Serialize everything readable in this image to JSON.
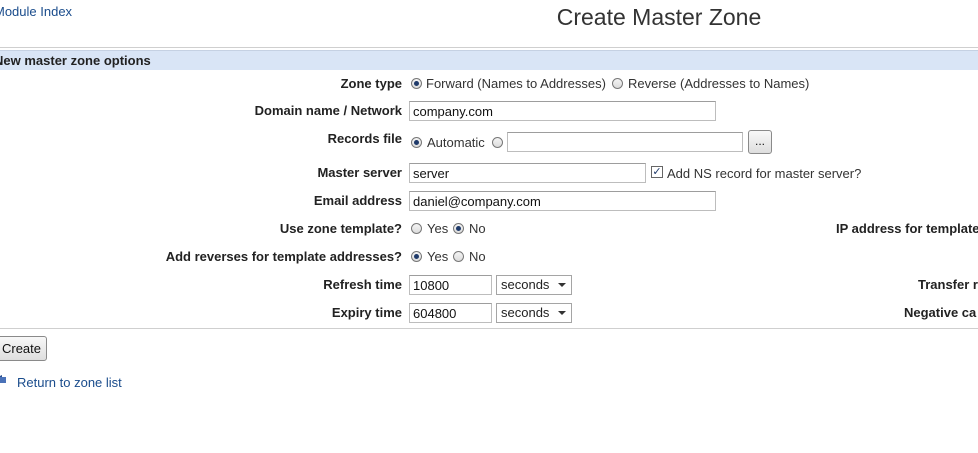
{
  "header": {
    "module_index": "Module Index",
    "title": "Create Master Zone"
  },
  "section": {
    "title": "New master zone options"
  },
  "zone_type": {
    "label": "Zone type",
    "options": [
      "Forward (Names to Addresses)",
      "Reverse (Addresses to Names)"
    ],
    "selected": "Forward (Names to Addresses)"
  },
  "domain": {
    "label": "Domain name / Network",
    "value": "company.com"
  },
  "records_file": {
    "label": "Records file",
    "option_auto": "Automatic",
    "value": "",
    "browse": "..."
  },
  "master_server": {
    "label": "Master server",
    "value": "server",
    "ns_label": "Add NS record for master server?",
    "ns_checked": true
  },
  "email": {
    "label": "Email address",
    "value": "daniel@company.com"
  },
  "use_template": {
    "label": "Use zone template?",
    "yes": "Yes",
    "no": "No",
    "selected": "No"
  },
  "ip_template": {
    "label": "IP address for template"
  },
  "add_reverses": {
    "label": "Add reverses for template addresses?",
    "yes": "Yes",
    "no": "No",
    "selected": "Yes"
  },
  "refresh": {
    "label": "Refresh time",
    "value": "10800",
    "unit": "seconds"
  },
  "transfer": {
    "label": "Transfer r"
  },
  "expiry": {
    "label": "Expiry time",
    "value": "604800",
    "unit": "seconds"
  },
  "negative": {
    "label": "Negative ca"
  },
  "actions": {
    "create": "Create",
    "return": "Return to zone list"
  },
  "colors": {
    "header_bg": "#d9e5f6",
    "link": "#1a4c8c"
  }
}
